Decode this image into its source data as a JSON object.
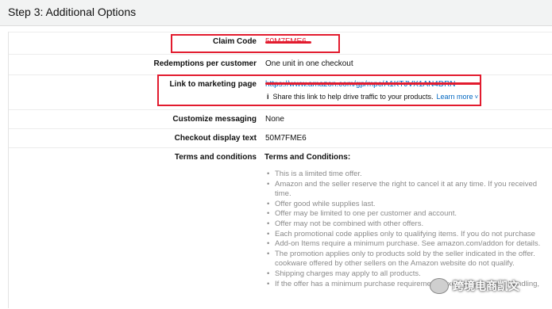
{
  "header": {
    "title": "Step 3: Additional Options"
  },
  "rows": {
    "claim_code": {
      "label": "Claim Code",
      "value": "50M7FME6"
    },
    "redemptions": {
      "label": "Redemptions per customer",
      "value": "One unit in one checkout"
    },
    "marketing": {
      "label": "Link to marketing page",
      "value": "https://www.amazon.com/gp/mpc/A1KTJVX1AN4DRN",
      "info_icon": "i",
      "info_text": "Share this link to help drive traffic to your products.",
      "learn_more": "Learn more",
      "chevron": "˅"
    },
    "customize": {
      "label": "Customize messaging",
      "value": "None"
    },
    "checkout": {
      "label": "Checkout display text",
      "value": "50M7FME6"
    },
    "terms": {
      "label": "Terms and conditions",
      "title": "Terms and Conditions:"
    }
  },
  "terms_items": [
    "This is a limited time offer.",
    "Amazon and the seller reserve the right to cancel it at any time. If you received",
    "time.",
    "Offer good while supplies last.",
    "Offer may be limited to one per customer and account.",
    "Offer may not be combined with other offers.",
    "Each promotional code applies only to qualifying items. If you do not purchase",
    "Add-on Items require a minimum purchase. See amazon.com/addon for details.",
    "The promotion applies only to products sold by the seller indicated in the offer.",
    "cookware offered by other sellers on the Amazon website do not qualify.",
    "Shipping charges may apply to all products.",
    "If the offer has a minimum purchase requirement, taxes, shipping and handling,"
  ],
  "watermark": {
    "text": "跨境电商凯文"
  },
  "colors": {
    "highlight": "#e21b2e",
    "link": "#0066c0",
    "header_bg": "#f2f3f3"
  }
}
